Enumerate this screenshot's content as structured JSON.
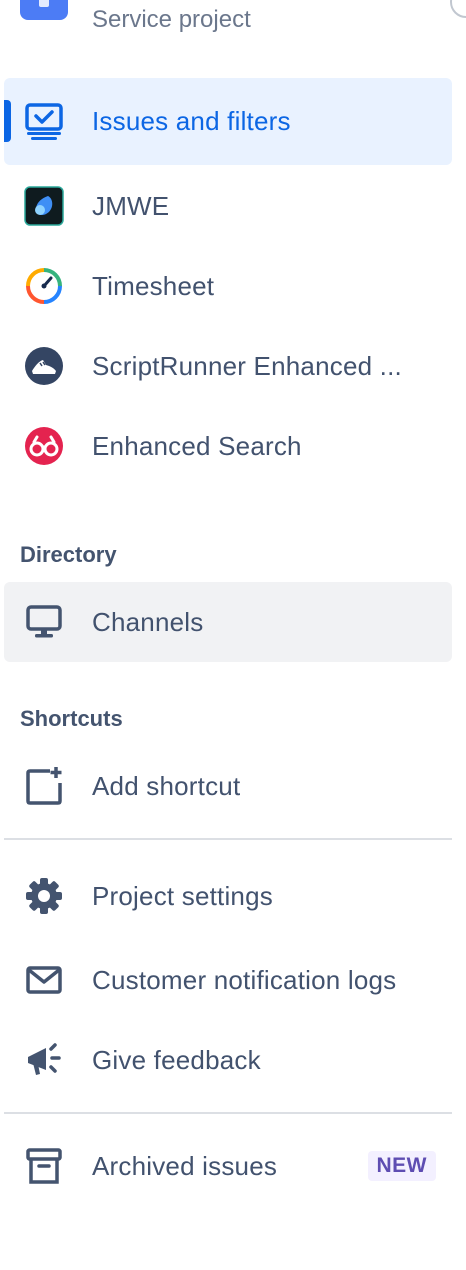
{
  "project": {
    "type_label": "Service project"
  },
  "apps": [
    {
      "label": "Issues and filters",
      "icon": "issues-filters-icon"
    },
    {
      "label": "JMWE",
      "icon": "jmwe-app-icon"
    },
    {
      "label": "Timesheet",
      "icon": "timesheet-app-icon"
    },
    {
      "label": "ScriptRunner Enhanced ...",
      "icon": "scriptrunner-app-icon"
    },
    {
      "label": "Enhanced Search",
      "icon": "enhanced-search-app-icon"
    }
  ],
  "directory": {
    "heading": "Directory",
    "items": [
      {
        "label": "Channels",
        "icon": "monitor-icon"
      }
    ]
  },
  "shortcuts": {
    "heading": "Shortcuts",
    "items": [
      {
        "label": "Add shortcut",
        "icon": "add-shortcut-icon"
      }
    ]
  },
  "settings": [
    {
      "label": "Project settings",
      "icon": "gear-icon"
    },
    {
      "label": "Customer notification logs",
      "icon": "envelope-icon"
    },
    {
      "label": "Give feedback",
      "icon": "megaphone-icon"
    }
  ],
  "archive": {
    "label": "Archived issues",
    "badge": "NEW",
    "icon": "archive-box-icon"
  },
  "colors": {
    "selected_bg": "#e9f2ff",
    "selected_text": "#0c66e4",
    "hover_bg": "#f1f2f4",
    "text": "#42526e",
    "badge_bg": "#f3f0ff",
    "badge_text": "#5e4db2"
  }
}
